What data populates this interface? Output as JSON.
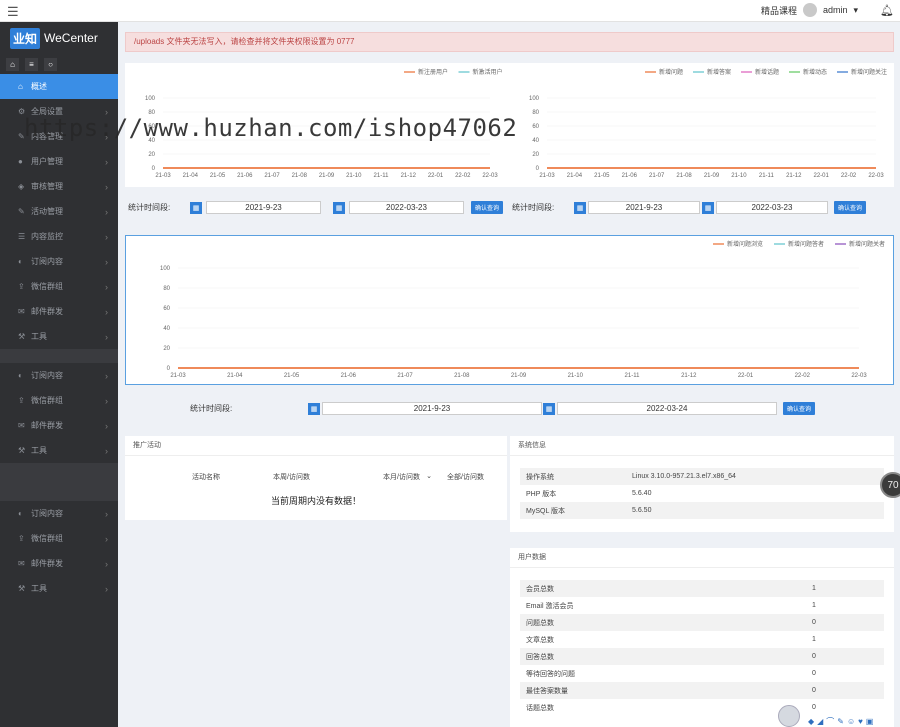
{
  "topbar": {
    "menu_icon": "hamburger-icon",
    "link": "精品课程",
    "user": "admin",
    "caret": "▾"
  },
  "sidebar": {
    "logo_box": "业知",
    "logo_name": "WeCenter",
    "items": [
      {
        "label": "概述",
        "icon": "home-icon",
        "active": true
      },
      {
        "label": "全局设置",
        "icon": "gear-icon"
      },
      {
        "label": "内容管理",
        "icon": "edit-icon"
      },
      {
        "label": "用户管理",
        "icon": "user-icon"
      },
      {
        "label": "审核管理",
        "icon": "shield-icon"
      },
      {
        "label": "活动管理",
        "icon": "edit-icon"
      },
      {
        "label": "内容监控",
        "icon": "list-icon"
      },
      {
        "label": "订阅内容",
        "icon": "moon-icon"
      },
      {
        "label": "微信群组",
        "icon": "share-icon"
      },
      {
        "label": "邮件群发",
        "icon": "mail-icon"
      },
      {
        "label": "工具",
        "icon": "tool-icon"
      },
      {
        "label": "订阅内容",
        "icon": "moon-icon"
      },
      {
        "label": "微信群组",
        "icon": "share-icon"
      },
      {
        "label": "邮件群发",
        "icon": "mail-icon"
      },
      {
        "label": "工具",
        "icon": "tool-icon"
      },
      {
        "label": "订阅内容",
        "icon": "moon-icon"
      },
      {
        "label": "微信群组",
        "icon": "share-icon"
      },
      {
        "label": "邮件群发",
        "icon": "mail-icon"
      },
      {
        "label": "工具",
        "icon": "tool-icon"
      }
    ]
  },
  "alert": "/uploads 文件夹无法写入，请检查并将文件夹权限设置为 0777",
  "watermark": "https://www.huzhan.com/ishop47062",
  "colors": {
    "primary": "#3a8ee6",
    "orange": "#ef8a5a",
    "teal": "#7ecfd6",
    "pink": "#e27ec8",
    "green": "#7fd27f",
    "blue": "#5b8fd6",
    "purple": "#a070c8",
    "alert_bg": "#f6dede"
  },
  "chart_data": [
    {
      "type": "line",
      "title": "",
      "categories": [
        "21-03",
        "21-04",
        "21-05",
        "21-06",
        "21-07",
        "21-08",
        "21-09",
        "21-10",
        "21-11",
        "21-12",
        "22-01",
        "22-02",
        "22-03"
      ],
      "yticks": [
        0,
        20,
        40,
        60,
        80,
        100
      ],
      "ylim": [
        0,
        100
      ],
      "legend_position": "top-right",
      "series": [
        {
          "name": "新注册用户",
          "color": "#ef8a5a",
          "values": [
            0,
            0,
            0,
            0,
            0,
            0,
            0,
            0,
            0,
            0,
            0,
            0,
            0
          ]
        },
        {
          "name": "新激活用户",
          "color": "#7ecfd6",
          "values": [
            0,
            0,
            0,
            0,
            0,
            0,
            0,
            0,
            0,
            0,
            0,
            0,
            0
          ]
        }
      ]
    },
    {
      "type": "line",
      "title": "",
      "categories": [
        "21-03",
        "21-04",
        "21-05",
        "21-06",
        "21-07",
        "21-08",
        "21-09",
        "21-10",
        "21-11",
        "21-12",
        "22-01",
        "22-02",
        "22-03"
      ],
      "yticks": [
        0,
        20,
        40,
        60,
        80,
        100
      ],
      "ylim": [
        0,
        100
      ],
      "legend_position": "top-right",
      "series": [
        {
          "name": "新增问题",
          "color": "#ef8a5a",
          "values": [
            0,
            0,
            0,
            0,
            0,
            0,
            0,
            0,
            0,
            0,
            0,
            0,
            0
          ]
        },
        {
          "name": "新增答案",
          "color": "#7ecfd6",
          "values": [
            0,
            0,
            0,
            0,
            0,
            0,
            0,
            0,
            0,
            0,
            0,
            0,
            0
          ]
        },
        {
          "name": "新增话题",
          "color": "#e27ec8",
          "values": [
            0,
            0,
            0,
            0,
            0,
            0,
            0,
            0,
            0,
            0,
            0,
            0,
            0
          ]
        },
        {
          "name": "新增动态",
          "color": "#7fd27f",
          "values": [
            0,
            0,
            0,
            0,
            0,
            0,
            0,
            0,
            0,
            0,
            0,
            0,
            0
          ]
        },
        {
          "name": "新增问题关注",
          "color": "#5b8fd6",
          "values": [
            0,
            0,
            0,
            0,
            0,
            0,
            0,
            0,
            0,
            0,
            0,
            0,
            0
          ]
        }
      ]
    },
    {
      "type": "line",
      "title": "",
      "categories": [
        "21-03",
        "21-04",
        "21-05",
        "21-06",
        "21-07",
        "21-08",
        "21-09",
        "21-10",
        "21-11",
        "21-12",
        "22-01",
        "22-02",
        "22-03"
      ],
      "yticks": [
        0,
        20,
        40,
        60,
        80,
        100
      ],
      "ylim": [
        0,
        100
      ],
      "legend_position": "top-right",
      "series": [
        {
          "name": "新增问题浏览",
          "color": "#ef8a5a",
          "values": [
            0,
            0,
            0,
            0,
            0,
            0,
            0,
            0,
            0,
            0,
            0,
            0,
            0
          ]
        },
        {
          "name": "新增问题答者",
          "color": "#7ecfd6",
          "values": [
            0,
            0,
            0,
            0,
            0,
            0,
            0,
            0,
            0,
            0,
            0,
            0,
            0
          ]
        },
        {
          "name": "新增问题关者",
          "color": "#a070c8",
          "values": [
            0,
            0,
            0,
            0,
            0,
            0,
            0,
            0,
            0,
            0,
            0,
            0,
            0
          ]
        }
      ]
    }
  ],
  "query1": {
    "label": "统计时间段:",
    "start": "2021-9-23",
    "end": "2022-03-23",
    "button": "确认查询"
  },
  "query2": {
    "label": "统计时间段:",
    "start": "2021-9-23",
    "end": "2022-03-23",
    "button": "确认查询"
  },
  "query3": {
    "label": "统计时间段:",
    "start": "2021-9-23",
    "end": "2022-03-24",
    "button": "确认查询"
  },
  "promo": {
    "title": "推广活动",
    "headers": [
      "活动名称",
      "本周/访问数",
      "本月/访问数",
      "全部/访问数"
    ],
    "empty": "当前周期内没有数据！"
  },
  "sysinfo": {
    "title": "系统信息",
    "rows": [
      {
        "k": "操作系统",
        "v": "Linux 3.10.0-957.21.3.el7.x86_64"
      },
      {
        "k": "PHP 版本",
        "v": "5.6.40"
      },
      {
        "k": "MySQL 版本",
        "v": "5.6.50"
      }
    ]
  },
  "userstats": {
    "title": "用户数据",
    "rows": [
      {
        "k": "会员总数",
        "v": "1"
      },
      {
        "k": "Email 激活会员",
        "v": "1"
      },
      {
        "k": "问题总数",
        "v": "0"
      },
      {
        "k": "文章总数",
        "v": "1"
      },
      {
        "k": "回答总数",
        "v": "0"
      },
      {
        "k": "等待回答的问题",
        "v": "0"
      },
      {
        "k": "最佳答案数量",
        "v": "0"
      },
      {
        "k": "话题总数",
        "v": "0"
      }
    ]
  },
  "bubble": "70"
}
